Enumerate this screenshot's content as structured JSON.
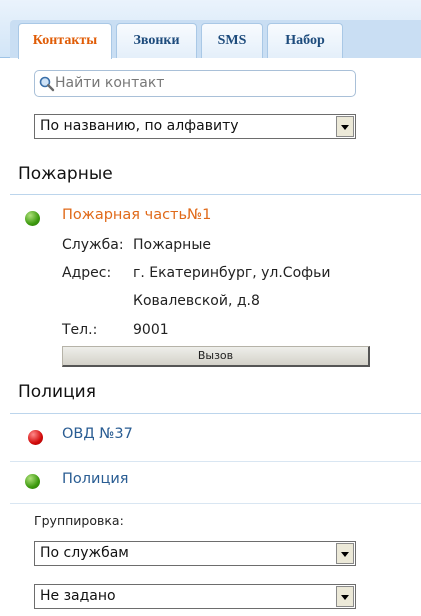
{
  "tabs": [
    {
      "label": "Контакты",
      "active": true
    },
    {
      "label": "Звонки",
      "active": false
    },
    {
      "label": "SMS",
      "active": false
    },
    {
      "label": "Набор",
      "active": false
    }
  ],
  "search": {
    "placeholder": "Найти контакт",
    "icon": "magnifier-icon"
  },
  "sort_select": {
    "value": "По названию, по алфавиту"
  },
  "groups": [
    {
      "title": "Пожарные",
      "contacts": [
        {
          "name": "Пожарная часть№1",
          "status": "online",
          "status_color": "#3d9a0f",
          "name_color": "#e06a1a",
          "service_label": "Служба:",
          "service_value": "Пожарные",
          "address_label": "Адрес:",
          "address_line1": "г. Екатеринбург, ул.Софьи",
          "address_line2": "Ковалевской, д.8",
          "phone_label": "Тел.:",
          "phone_value": "9001",
          "call_label": "Вызов"
        }
      ]
    },
    {
      "title": "Полиция",
      "contacts": [
        {
          "name": "ОВД №37",
          "status": "offline",
          "status_color": "#d20a0a",
          "name_color": "#2a5d93"
        },
        {
          "name": "Полиция",
          "status": "online",
          "status_color": "#3d9a0f",
          "name_color": "#2a5d93"
        }
      ]
    }
  ],
  "grouping": {
    "label": "Группировка:",
    "select1": "По службам",
    "select2": "Не задано"
  }
}
